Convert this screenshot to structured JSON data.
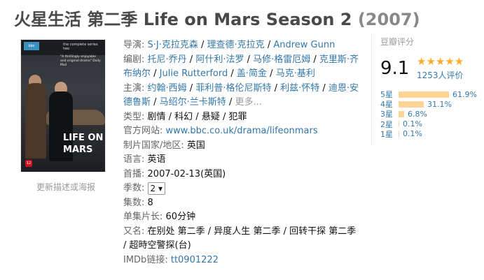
{
  "title": {
    "main": "火星生活 第二季 Life on Mars Season 2",
    "year": "(2007)"
  },
  "poster": {
    "series_text": "the complete series two",
    "quote": "\"A thrillingly enjoyable and original drama\" Daily Mail",
    "logo_line1": "LIFE ON",
    "logo_line2": "MARS",
    "age_rating": "12"
  },
  "update_link": "更新描述或海报",
  "info": {
    "director_label": "导演:",
    "directors": [
      "S·J·克拉克森",
      "理查德·克拉克",
      "Andrew Gunn"
    ],
    "writer_label": "编剧:",
    "writers": [
      "托尼·乔丹",
      "阿什利·法罗",
      "马修·格雷厄姆",
      "克里斯·齐布纳尔",
      "Julie Rutterford",
      "盖·简金",
      "马克·基利"
    ],
    "cast_label": "主演:",
    "cast": [
      "约翰·西姆",
      "菲利普·格伦尼斯特",
      "利兹·怀特",
      "迪恩·安德鲁斯",
      "马绍尔·兰卡斯特"
    ],
    "cast_more": "更多...",
    "genre_label": "类型:",
    "genre_value": "剧情 / 科幻 / 悬疑 / 犯罪",
    "website_label": "官方网站:",
    "website_value": "www.bbc.co.uk/drama/lifeonmars",
    "country_label": "制片国家/地区:",
    "country_value": "英国",
    "language_label": "语言:",
    "language_value": "英语",
    "premiere_label": "首播:",
    "premiere_value": "2007-02-13(英国)",
    "season_label": "季数:",
    "season_value": "2 ▾",
    "episodes_label": "集数:",
    "episodes_value": "8",
    "runtime_label": "单集片长:",
    "runtime_value": "60分钟",
    "aka_label": "又名:",
    "aka_value": "在别处 第二季 / 异度人生 第二季 / 回转干探 第二季 / 超時空警探(台)",
    "imdb_label": "IMDb链接:",
    "imdb_value": "tt0901222"
  },
  "rating": {
    "title": "豆瓣评分",
    "score": "9.1",
    "stars": "★★★★★",
    "votes": "1253人评价",
    "bars": [
      {
        "label": "5星",
        "pct": "61.9%",
        "value": 61.9
      },
      {
        "label": "4星",
        "pct": "31.1%",
        "value": 31.1
      },
      {
        "label": "3星",
        "pct": "6.8%",
        "value": 6.8
      },
      {
        "label": "2星",
        "pct": "0.1%",
        "value": 0.1
      },
      {
        "label": "1星",
        "pct": "0.1%",
        "value": 0.1
      }
    ]
  }
}
